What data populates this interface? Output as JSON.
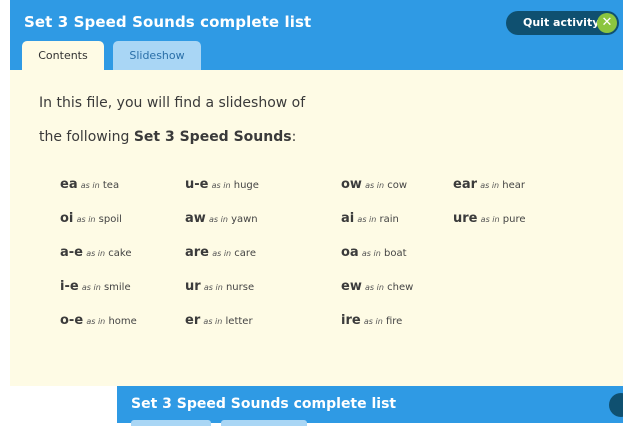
{
  "app": {
    "title": "Set 3 Speed Sounds complete list",
    "quit_label": "Quit activity",
    "quit_icon": "close-icon"
  },
  "tabs": [
    {
      "label": "Contents",
      "active": true
    },
    {
      "label": "Slideshow",
      "active": false
    }
  ],
  "intro": {
    "line1": "In this file, you will find a slideshow of",
    "line2_prefix": "the following ",
    "line2_bold": "Set 3 Speed Sounds",
    "line2_suffix": ":"
  },
  "as_in": "as in",
  "sounds": [
    {
      "grapheme": "ea",
      "word": "tea"
    },
    {
      "grapheme": "u-e",
      "word": "huge"
    },
    {
      "grapheme": "ow",
      "word": "cow"
    },
    {
      "grapheme": "ear",
      "word": "hear"
    },
    {
      "grapheme": "oi",
      "word": "spoil"
    },
    {
      "grapheme": "aw",
      "word": "yawn"
    },
    {
      "grapheme": "ai",
      "word": "rain"
    },
    {
      "grapheme": "ure",
      "word": "pure"
    },
    {
      "grapheme": "a-e",
      "word": "cake"
    },
    {
      "grapheme": "are",
      "word": "care"
    },
    {
      "grapheme": "oa",
      "word": "boat"
    },
    {
      "grapheme": "i-e",
      "word": "smile"
    },
    {
      "grapheme": "ur",
      "word": "nurse"
    },
    {
      "grapheme": "ew",
      "word": "chew"
    },
    {
      "grapheme": "o-e",
      "word": "home"
    },
    {
      "grapheme": "er",
      "word": "letter"
    },
    {
      "grapheme": "ire",
      "word": "fire"
    }
  ],
  "bottom_bar": {
    "title": "Set 3 Speed Sounds complete list"
  },
  "colors": {
    "header_blue": "#2f9ae4",
    "content_bg": "#fefbe5",
    "quit_bg": "#0f5070",
    "quit_icon_green": "#8bc53f",
    "inactive_tab": "#a9d6f5"
  }
}
